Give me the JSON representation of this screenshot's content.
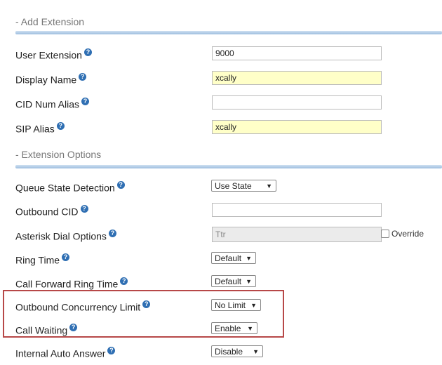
{
  "sections": {
    "add_extension": "- Add Extension",
    "extension_options": "- Extension Options"
  },
  "fields": {
    "user_extension": {
      "label": "User Extension",
      "value": "9000"
    },
    "display_name": {
      "label": "Display Name",
      "value": "xcally"
    },
    "cid_num_alias": {
      "label": "CID Num Alias",
      "value": ""
    },
    "sip_alias": {
      "label": "SIP Alias",
      "value": "xcally"
    },
    "queue_state_detection": {
      "label": "Queue State Detection",
      "value": "Use State"
    },
    "outbound_cid": {
      "label": "Outbound CID",
      "value": ""
    },
    "asterisk_dial_options": {
      "label": "Asterisk Dial Options",
      "value": "Ttr",
      "override_label": "Override"
    },
    "ring_time": {
      "label": "Ring Time",
      "value": "Default"
    },
    "call_forward_ring_time": {
      "label": "Call Forward Ring Time",
      "value": "Default"
    },
    "outbound_concurrency_limit": {
      "label": "Outbound Concurrency Limit",
      "value": "No Limit"
    },
    "call_waiting": {
      "label": "Call Waiting",
      "value": "Enable"
    },
    "internal_auto_answer": {
      "label": "Internal Auto Answer",
      "value": "Disable"
    }
  },
  "icons": {
    "help": "question-circle-icon",
    "dropdown": "caret-down-icon"
  },
  "colors": {
    "yellow_field": "#ffffc8",
    "help_icon": "#2f6fb3",
    "highlight_border": "#b74848"
  }
}
